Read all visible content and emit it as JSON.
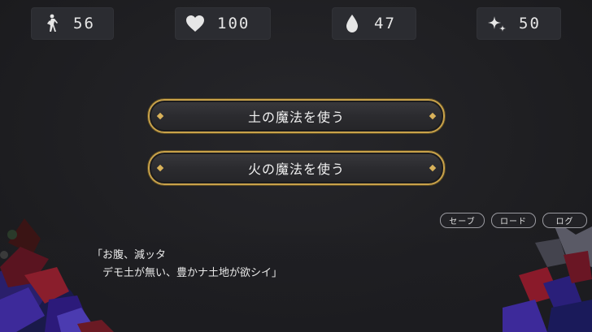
{
  "stats": {
    "steps": {
      "icon": "walking-person-icon",
      "value": "56"
    },
    "health": {
      "icon": "heart-icon",
      "value": "100"
    },
    "water": {
      "icon": "water-drop-icon",
      "value": "47"
    },
    "magic": {
      "icon": "sparkle-icon",
      "value": "50"
    }
  },
  "choices": [
    {
      "label": "土の魔法を使う"
    },
    {
      "label": "火の魔法を使う"
    }
  ],
  "system_buttons": {
    "save": "セーブ",
    "load": "ロード",
    "log": "ログ"
  },
  "message": {
    "line1": "「お腹、減ッタ",
    "line2": "　デモ土が無い、豊かナ土地が欲シイ」"
  },
  "colors": {
    "accent_gold": "#c9a24a",
    "background": "#1f1f22",
    "panel": "#2b2c31"
  }
}
